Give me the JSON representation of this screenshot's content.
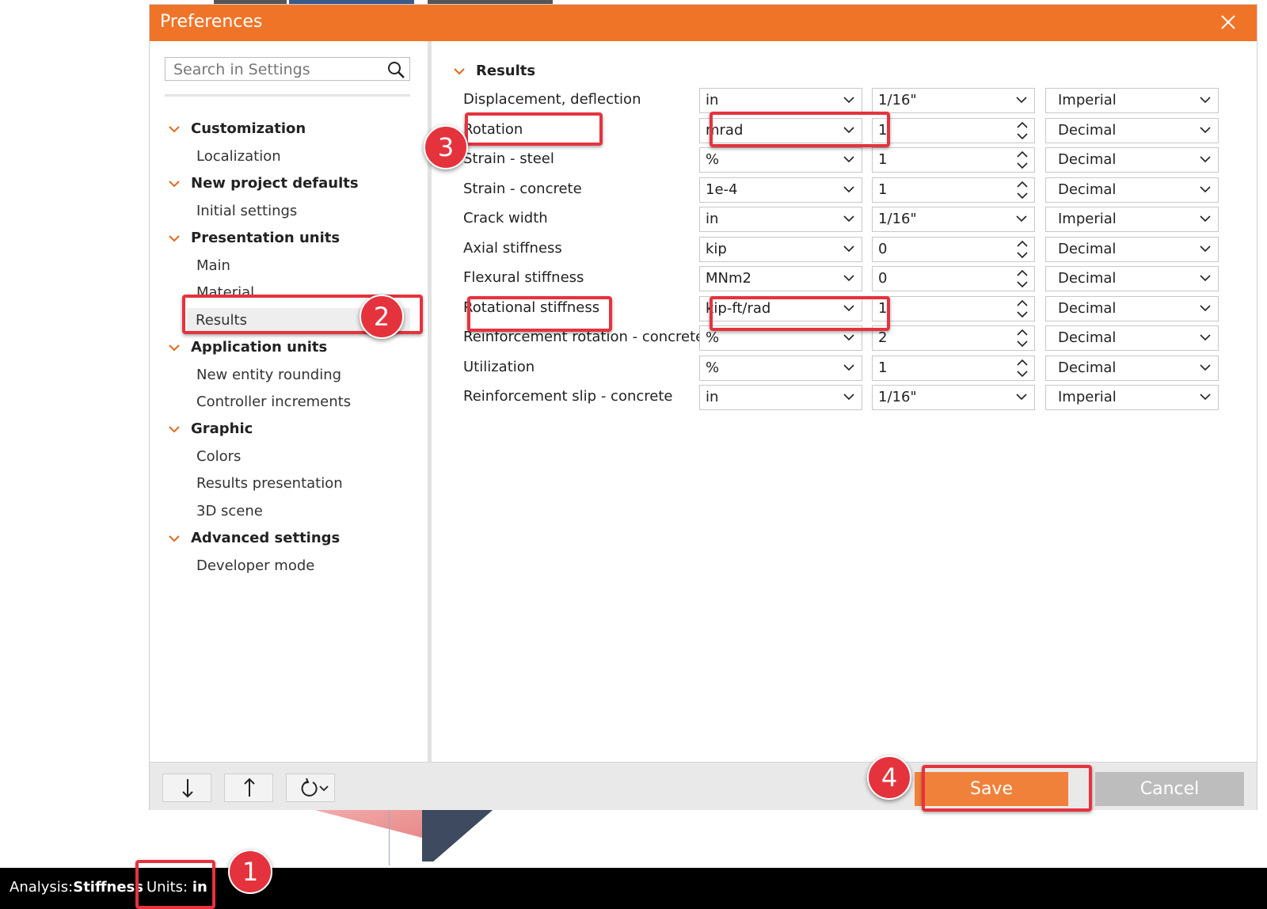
{
  "dialog": {
    "title": "Preferences",
    "close_icon": "close-icon"
  },
  "search": {
    "placeholder": "Search in Settings",
    "icon": "search-icon"
  },
  "tree": {
    "groups": [
      {
        "label": "Customization",
        "items": [
          "Localization"
        ]
      },
      {
        "label": "New project defaults",
        "items": [
          "Initial settings"
        ]
      },
      {
        "label": "Presentation units",
        "items": [
          "Main",
          "Material",
          "Results"
        ]
      },
      {
        "label": "Application units",
        "items": [
          "New entity rounding",
          "Controller increments"
        ]
      },
      {
        "label": "Graphic",
        "items": [
          "Colors",
          "Results presentation",
          "3D scene"
        ]
      },
      {
        "label": "Advanced settings",
        "items": [
          "Developer mode"
        ]
      }
    ],
    "selected": "Results"
  },
  "section": {
    "title": "Results",
    "rows": [
      {
        "label": "Displacement, deflection",
        "unit": "in",
        "precision": "1/16\"",
        "precision_type": "dropdown",
        "format": "Imperial"
      },
      {
        "label": "Rotation",
        "unit": "mrad",
        "precision": "1",
        "precision_type": "spin",
        "format": "Decimal"
      },
      {
        "label": "Strain - steel",
        "unit": "%",
        "precision": "1",
        "precision_type": "spin",
        "format": "Decimal"
      },
      {
        "label": "Strain - concrete",
        "unit": "1e-4",
        "precision": "1",
        "precision_type": "spin",
        "format": "Decimal"
      },
      {
        "label": "Crack width",
        "unit": "in",
        "precision": "1/16\"",
        "precision_type": "dropdown",
        "format": "Imperial"
      },
      {
        "label": "Axial stiffness",
        "unit": "kip",
        "precision": "0",
        "precision_type": "spin",
        "format": "Decimal"
      },
      {
        "label": "Flexural stiffness",
        "unit": "MNm2",
        "precision": "0",
        "precision_type": "spin",
        "format": "Decimal"
      },
      {
        "label": "Rotational stiffness",
        "unit": "kip-ft/rad",
        "precision": "1",
        "precision_type": "spin",
        "format": "Decimal"
      },
      {
        "label": "Reinforcement rotation - concrete",
        "unit": "%",
        "precision": "2",
        "precision_type": "spin",
        "format": "Decimal"
      },
      {
        "label": "Utilization",
        "unit": "%",
        "precision": "1",
        "precision_type": "spin",
        "format": "Decimal"
      },
      {
        "label": "Reinforcement slip - concrete",
        "unit": "in",
        "precision": "1/16\"",
        "precision_type": "dropdown",
        "format": "Imperial"
      }
    ]
  },
  "footer": {
    "save_label": "Save",
    "cancel_label": "Cancel",
    "tools": [
      "arrow-down-icon",
      "arrow-up-icon",
      "reset-icon"
    ]
  },
  "statusbar": {
    "analysis_label": "Analysis:",
    "analysis_value": "Stiffness",
    "units_label": "Units:",
    "units_value": "in"
  },
  "annotations": [
    "1",
    "2",
    "3",
    "4"
  ],
  "colors": {
    "accent": "#f07428",
    "highlight": "#e5333e",
    "save": "#f0813b",
    "cancel": "#bdbdbd"
  }
}
